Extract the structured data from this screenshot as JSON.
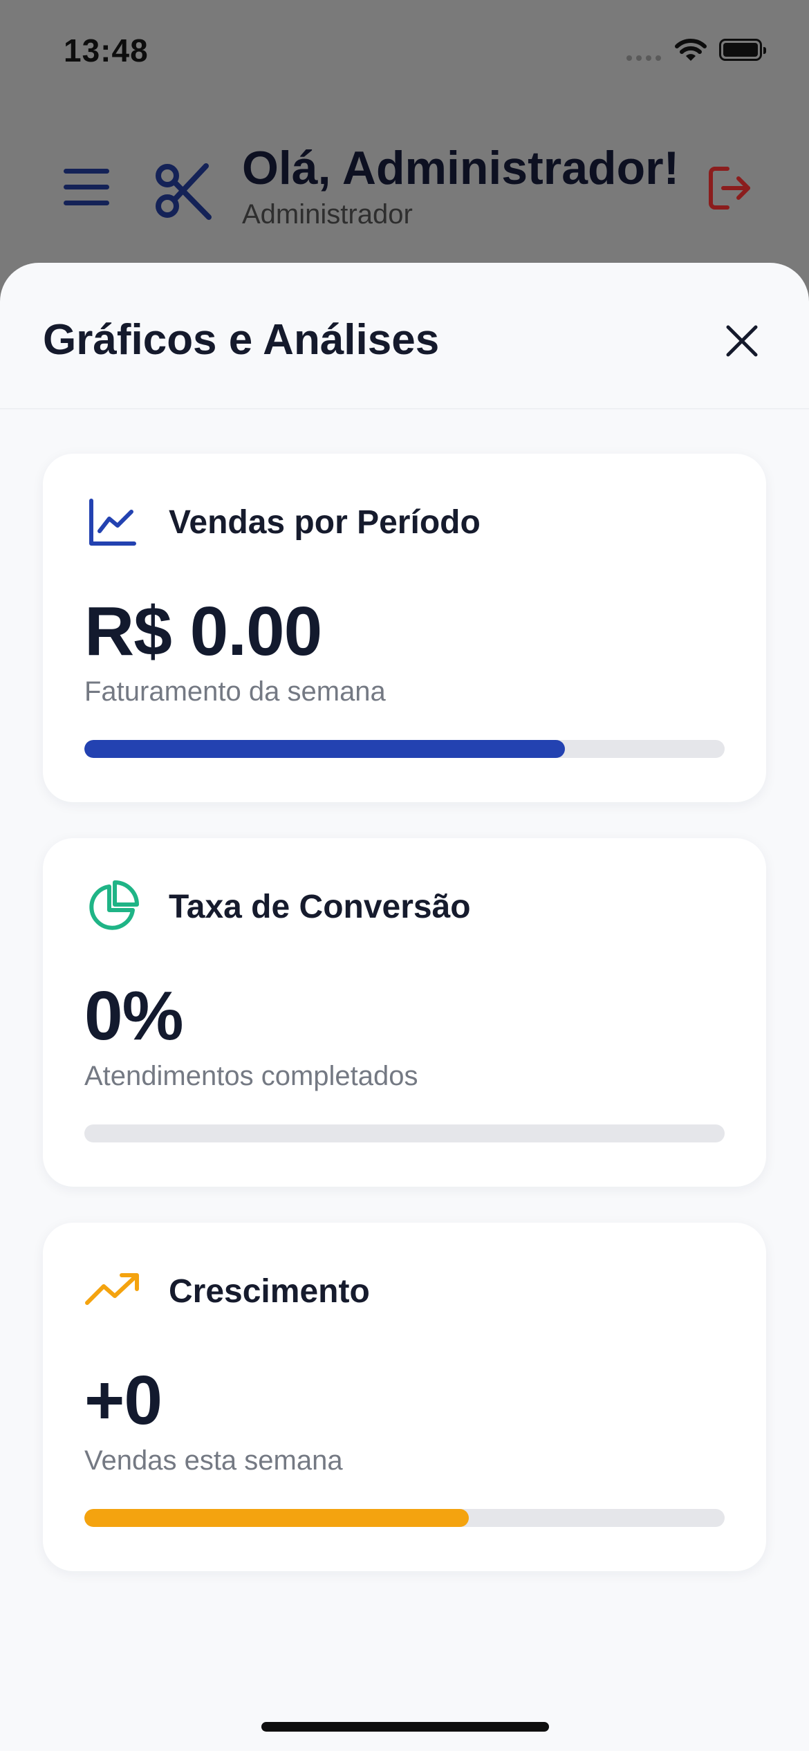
{
  "status_bar": {
    "time": "13:48"
  },
  "header": {
    "greeting": "Olá, Administrador!",
    "role": "Administrador"
  },
  "sheet": {
    "title": "Gráficos e Análises",
    "cards": [
      {
        "title": "Vendas por Período",
        "value": "R$ 0.00",
        "subtitle": "Faturamento da semana",
        "icon": "line-chart-icon",
        "color": "#2342b1",
        "progress": 0.75
      },
      {
        "title": "Taxa de Conversão",
        "value": "0%",
        "subtitle": "Atendimentos completados",
        "icon": "pie-chart-icon",
        "color": "#1fb486",
        "progress": 0
      },
      {
        "title": "Crescimento",
        "value": "+0",
        "subtitle": "Vendas esta semana",
        "icon": "trending-up-icon",
        "color": "#f4a30f",
        "progress": 0.6
      }
    ]
  }
}
